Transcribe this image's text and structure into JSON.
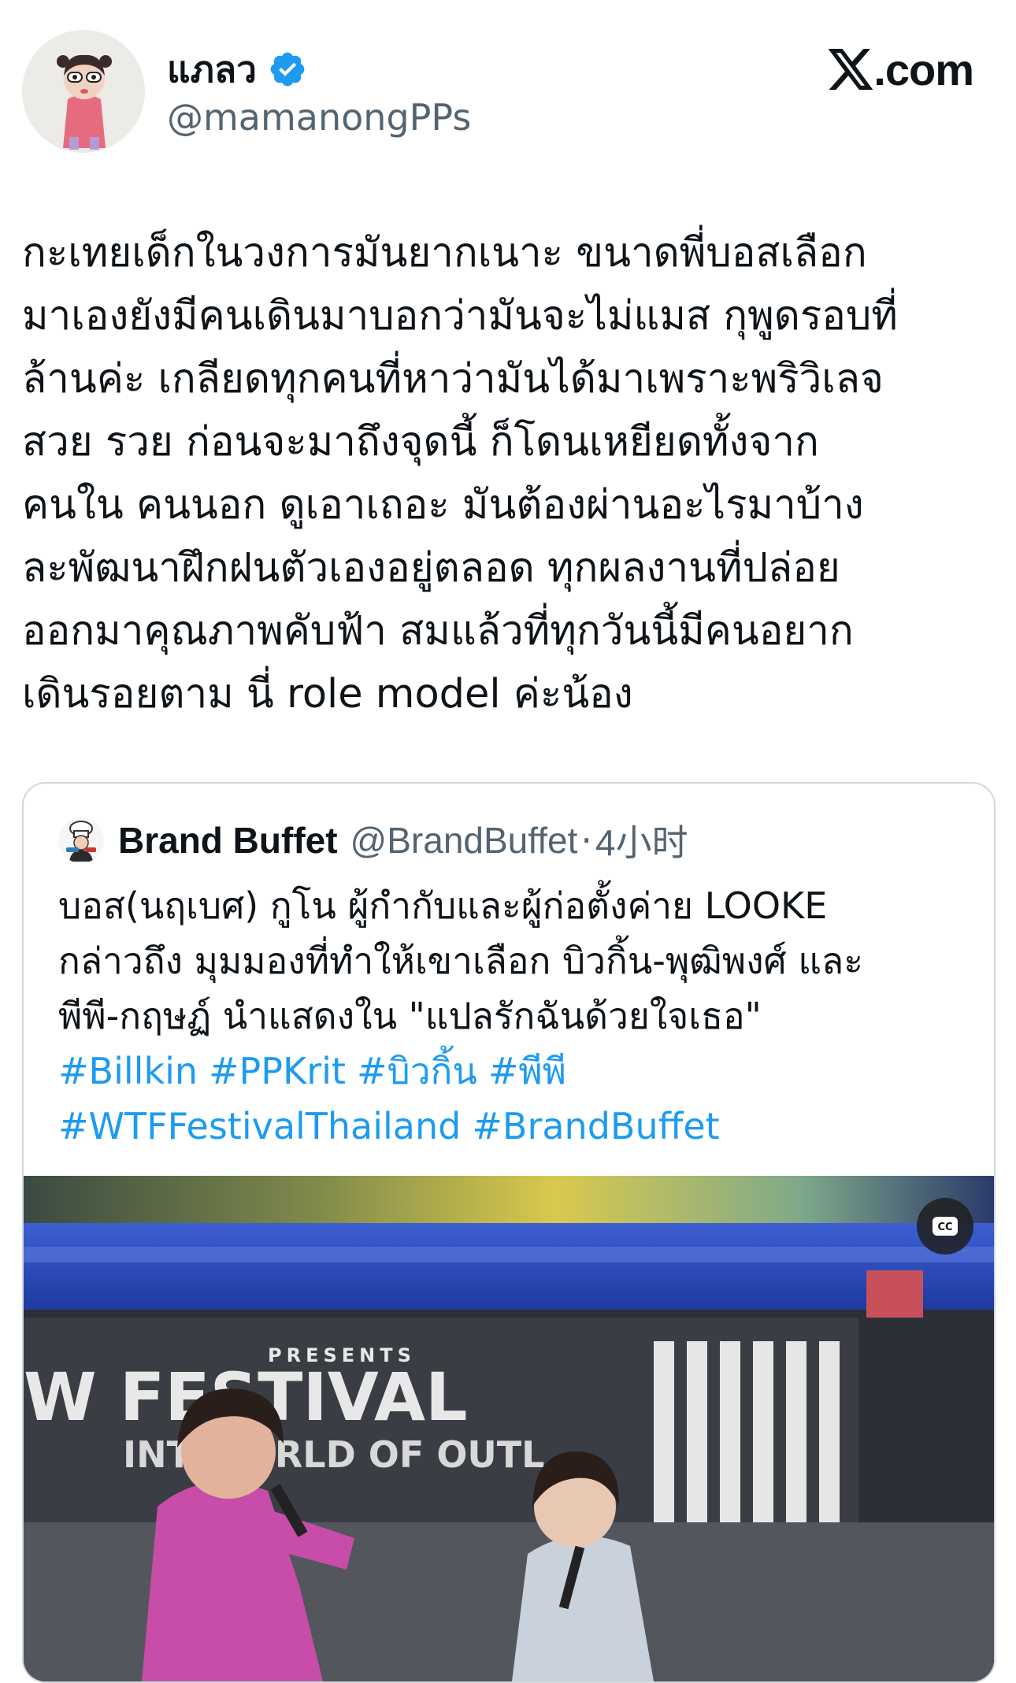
{
  "author": {
    "display_name": "แภลว",
    "handle": "@mamanongPPs"
  },
  "source_site": "X.com",
  "tweet_lines": [
    "กะเทยเด็กในวงการมันยากเนาะ ขนาดพี่บอสเลือก",
    "มาเองยังมีคนเดินมาบอกว่ามันจะไม่แมส กุพูดรอบที่",
    "ล้านค่ะ เกลียดทุกคนที่หาว่ามันได้มาเพราะพริวิเลจ",
    "สวย รวย ก่อนจะมาถึงจุดนี้ ก็โดนเหยียดทั้งจาก",
    "คนใน คนนอก ดูเอาเถอะ มันต้องผ่านอะไรมาบ้าง",
    "ละพัฒนาฝึกฝนตัวเองอยู่ตลอด ทุกผลงานที่ปล่อย",
    "ออกมาคุณภาพคับฟ้า สมแล้วที่ทุกวันนี้มีคนอยาก",
    "เดินรอยตาม นี่ role model ค่ะน้อง"
  ],
  "quote": {
    "display_name": "Brand Buffet",
    "handle": "@BrandBuffet",
    "separator": "·",
    "time": "4小时",
    "text_lines": [
      "บอส(นฤเบศ) กูโน ผู้กำกับและผู้ก่อตั้งค่าย LOOKE",
      "กล่าวถึง มุมมองที่ทำให้เขาเลือก บิวกิ้น-พุฒิพงศ์ และ",
      "พีพี-กฤษฏ์ นำแสดงใน \"แปลรักฉันด้วยใจเธอ\""
    ],
    "hashtag_lines": [
      [
        "#Billkin",
        "#PPKrit",
        "#บิวกิ้น",
        "#พีพี"
      ],
      [
        "#WTFFestivalThailand",
        "#BrandBuffet"
      ]
    ],
    "media": {
      "cc_label": "CC",
      "stage_sign_lines": [
        "PRESENTS",
        "W  FESTIVAL",
        "INT   WORLD OF OUTL"
      ]
    }
  },
  "colors": {
    "link": "#1d9bf0",
    "secondary_text": "#536471",
    "border": "#cfd9de",
    "verified": "#1d9bf0"
  }
}
